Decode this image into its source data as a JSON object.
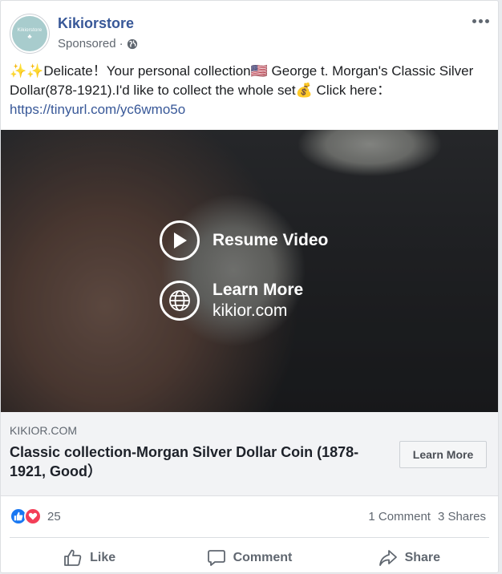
{
  "post": {
    "page_name": "Kikiorstore",
    "avatar_text": "Kikiorstore",
    "sponsored": "Sponsored",
    "separator": " · ",
    "body_text": "✨✨Delicate！Your personal collection🇺🇸 George t. Morgan's Classic Silver Dollar(878-1921).I'd like to collect the whole set💰 Click here：",
    "body_link": "https://tinyurl.com/yc6wmo5o"
  },
  "video": {
    "resume_label": "Resume Video",
    "learn_more_label": "Learn More",
    "domain": "kikior.com"
  },
  "link_preview": {
    "domain": "KIKIOR.COM",
    "title": "Classic collection-Morgan Silver Dollar Coin (1878-1921, Good）",
    "cta_label": "Learn More"
  },
  "engagement": {
    "reaction_count": "25",
    "comments": "1 Comment",
    "shares": "3 Shares"
  },
  "actions": {
    "like": "Like",
    "comment": "Comment",
    "share": "Share"
  },
  "colors": {
    "page_name": "#385898",
    "like_blue": "#1877f2",
    "love_red": "#f33e58",
    "avatar_teal": "#a8cccd"
  },
  "icons": [
    "more-icon",
    "globe-icon",
    "play-icon",
    "web-globe-icon",
    "like-reaction-icon",
    "love-reaction-icon",
    "thumbs-up-icon",
    "comment-icon",
    "share-icon"
  ]
}
